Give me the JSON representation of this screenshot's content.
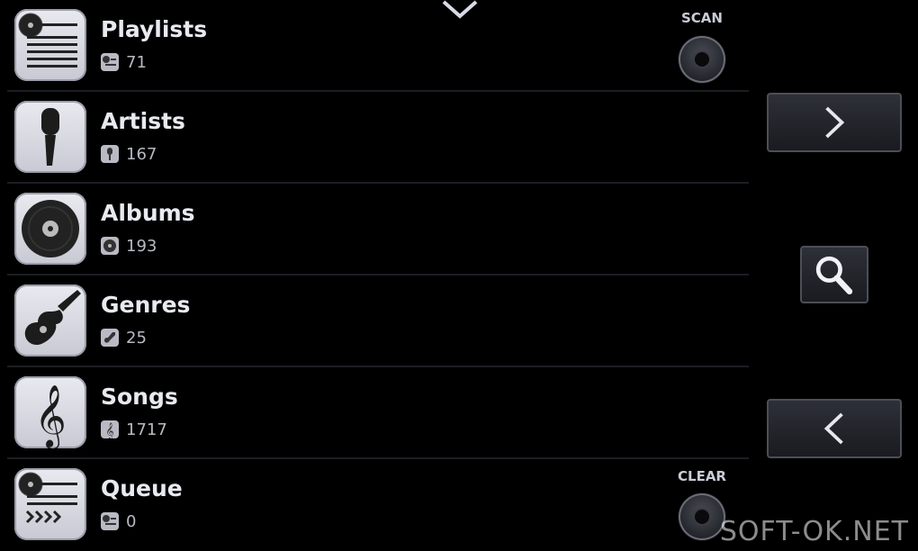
{
  "rows": [
    {
      "title": "Playlists",
      "count": "71",
      "icon": "playlist-icon",
      "mini": "playlist-mini-icon"
    },
    {
      "title": "Artists",
      "count": "167",
      "icon": "microphone-icon",
      "mini": "microphone-mini-icon"
    },
    {
      "title": "Albums",
      "count": "193",
      "icon": "disc-icon",
      "mini": "disc-mini-icon"
    },
    {
      "title": "Genres",
      "count": "25",
      "icon": "guitar-icon",
      "mini": "guitar-mini-icon"
    },
    {
      "title": "Songs",
      "count": "1717",
      "icon": "treble-clef-icon",
      "mini": "treble-clef-mini-icon"
    },
    {
      "title": "Queue",
      "count": "0",
      "icon": "queue-icon",
      "mini": "queue-mini-icon"
    }
  ],
  "actions": {
    "scan_label": "SCAN",
    "clear_label": "CLEAR"
  },
  "side_controls": {
    "forward_icon": "chevron-right-icon",
    "search_icon": "search-icon",
    "back_icon": "chevron-left-icon"
  },
  "watermark": "SOFT-OK.NET",
  "colors": {
    "background": "#000000",
    "text": "#e8eaf0",
    "icon_tile": "#d6d7df"
  }
}
